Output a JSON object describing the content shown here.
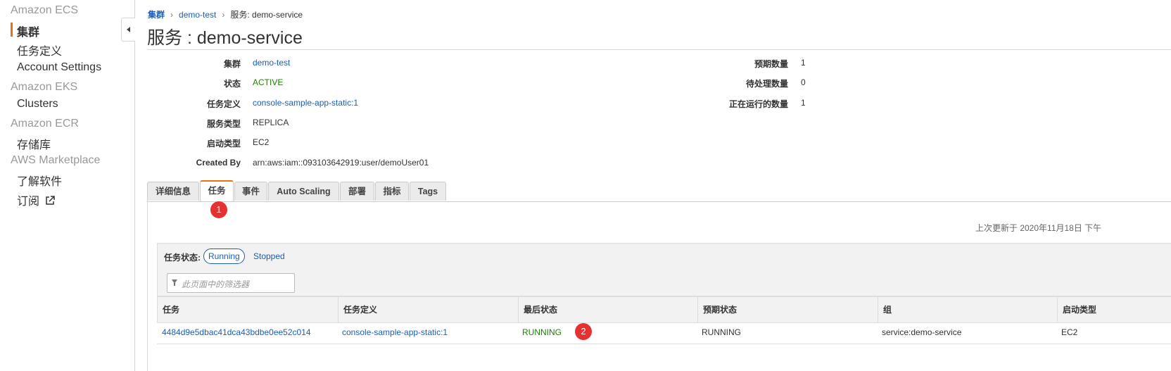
{
  "sidebar": {
    "groups": [
      {
        "title": "Amazon ECS",
        "items": [
          "集群",
          "任务定义",
          "Account Settings"
        ]
      },
      {
        "title": "Amazon EKS",
        "items": [
          "Clusters"
        ]
      },
      {
        "title": "Amazon ECR",
        "items": [
          "存储库"
        ]
      },
      {
        "title": "AWS Marketplace",
        "items": [
          "了解软件",
          "订阅"
        ]
      }
    ],
    "active_item": "集群",
    "accent_color": "#ec7211"
  },
  "breadcrumb": [
    "集群",
    "demo-test",
    "服务: demo-service"
  ],
  "page_title": "服务 : demo-service",
  "details_left": [
    {
      "label": "集群",
      "value": "demo-test"
    },
    {
      "label": "状态",
      "value": "ACTIVE"
    },
    {
      "label": "任务定义",
      "value": "console-sample-app-static:1"
    },
    {
      "label": "服务类型",
      "value": "REPLICA"
    },
    {
      "label": "启动类型",
      "value": "EC2"
    },
    {
      "label": "Created By",
      "value": "arn:aws:iam::093103642919:user/demoUser01"
    }
  ],
  "details_right": [
    {
      "label": "预期数量",
      "value": "1"
    },
    {
      "label": "待处理数量",
      "value": "0"
    },
    {
      "label": "正在运行的数量",
      "value": "1"
    }
  ],
  "tabs": [
    "详细信息",
    "任务",
    "事件",
    "Auto Scaling",
    "部署",
    "指标",
    "Tags"
  ],
  "active_tab": "任务",
  "markers": [
    "1",
    "2"
  ],
  "last_updated": "上次更新于 2020年11月18日 下午",
  "task_status": {
    "label": "任务状态:",
    "options": [
      "Running",
      "Stopped"
    ],
    "selected": "Running"
  },
  "filter": {
    "placeholder": "此页面中的筛选器"
  },
  "table": {
    "columns": [
      "任务",
      "任务定义",
      "最后状态",
      "预期状态",
      "组",
      "启动类型"
    ],
    "rows": [
      [
        "4484d9e5dbac41dca43bdbe0ee52c014",
        "console-sample-app-static:1",
        "RUNNING",
        "RUNNING",
        "service:demo-service",
        "EC2"
      ]
    ]
  },
  "colors": {
    "link": "#1a5fb4",
    "green": "#1d8102",
    "marker": "#e5312f"
  },
  "icons": [
    "collapse-arrow-icon",
    "external-link-icon",
    "filter-icon"
  ]
}
